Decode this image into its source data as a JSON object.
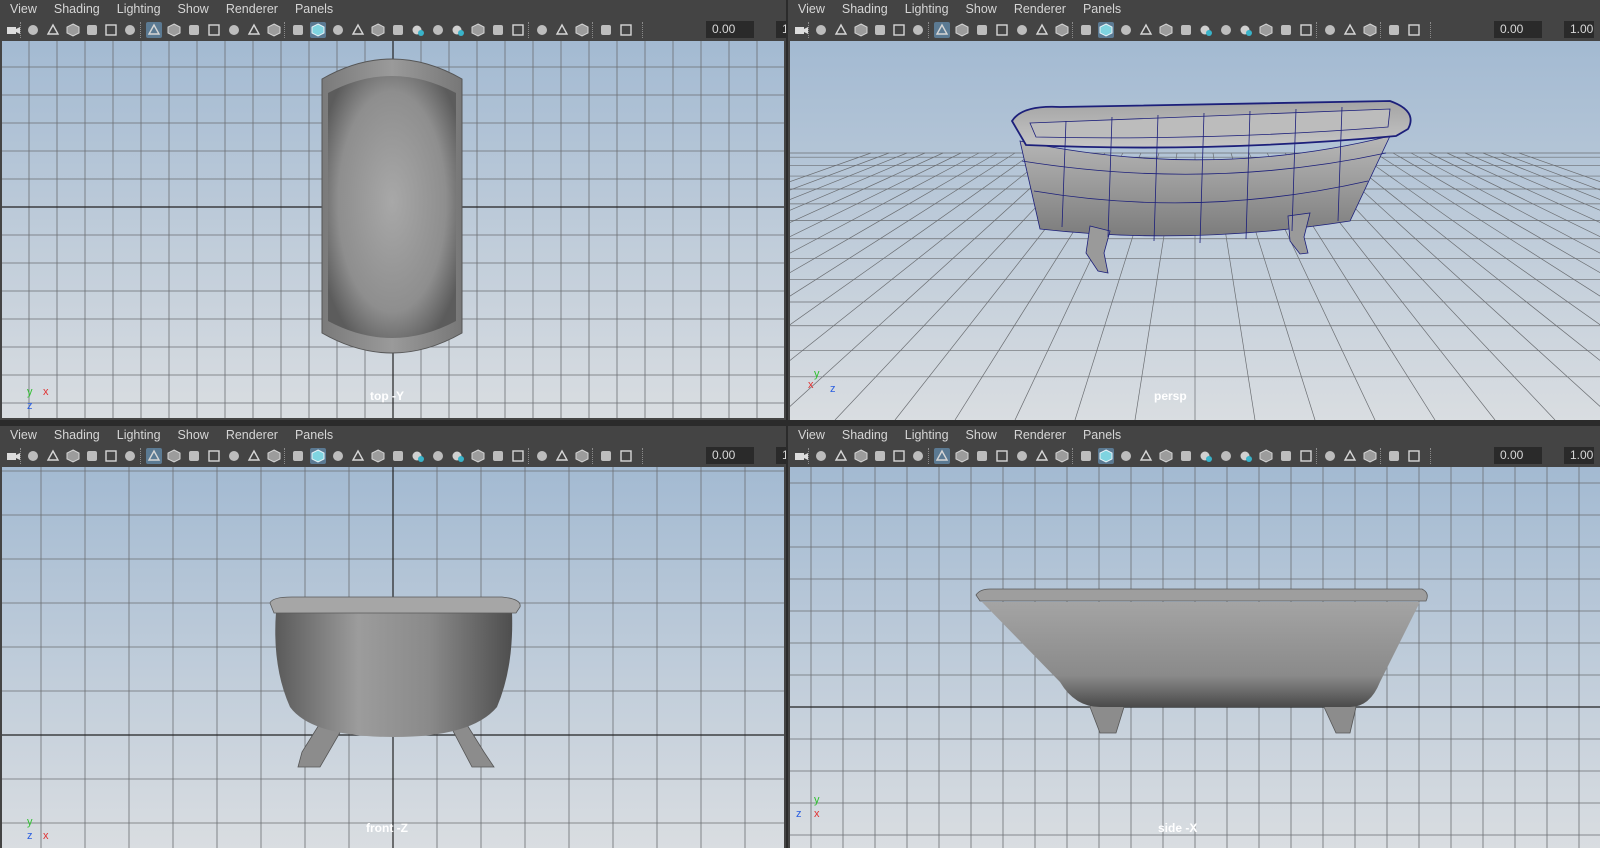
{
  "menu": [
    "View",
    "Shading",
    "Lighting",
    "Show",
    "Renderer",
    "Panels"
  ],
  "toolbar": {
    "icons": [
      "camera-icon",
      "camera-attributes-icon",
      "camera-bookmark-icon",
      "bookmark-icon",
      "image-plane-icon",
      "grease-pencil-icon",
      "pencil-icon",
      "grid-icon",
      "film-gate-icon",
      "resolution-gate-icon",
      "gate-mask-icon",
      "field-chart-icon",
      "safe-action-icon",
      "safe-title-icon",
      "wireframe-icon",
      "smooth-shade-icon",
      "default-material-icon",
      "wireframe-on-shaded-icon",
      "textured-icon",
      "use-all-lights-icon",
      "shadows-icon",
      "screen-space-ambient-occlusion-icon",
      "motion-blur-icon",
      "multisample-antialiasing-icon",
      "depth-of-field-icon",
      "isolate-select-icon",
      "xray-icon",
      "xray-joints-icon",
      "xray-components-icon",
      "exposure-icon",
      "gamma-icon"
    ],
    "exposure_value": "0.00",
    "gamma_value": "1.00"
  },
  "panels": [
    {
      "label": "top -Y",
      "axes": {
        "first": "y",
        "second": "x",
        "third": "z"
      }
    },
    {
      "label": "persp",
      "axes": {
        "first": "y",
        "second": "x",
        "third": "z"
      }
    },
    {
      "label": "front -Z",
      "axes": {
        "first": "y",
        "second": "z",
        "third": "x"
      }
    },
    {
      "label": "side -X",
      "axes": {
        "first": "y",
        "second": "z",
        "third": "x"
      }
    }
  ],
  "colors": {
    "viewport_top": "#a3bad2",
    "viewport_bottom": "#d9dde1",
    "grid": "#6b6e72",
    "mesh": "#8a8a8a",
    "active_toggle": "#5b7a93",
    "wire": "#1c1f7a"
  }
}
